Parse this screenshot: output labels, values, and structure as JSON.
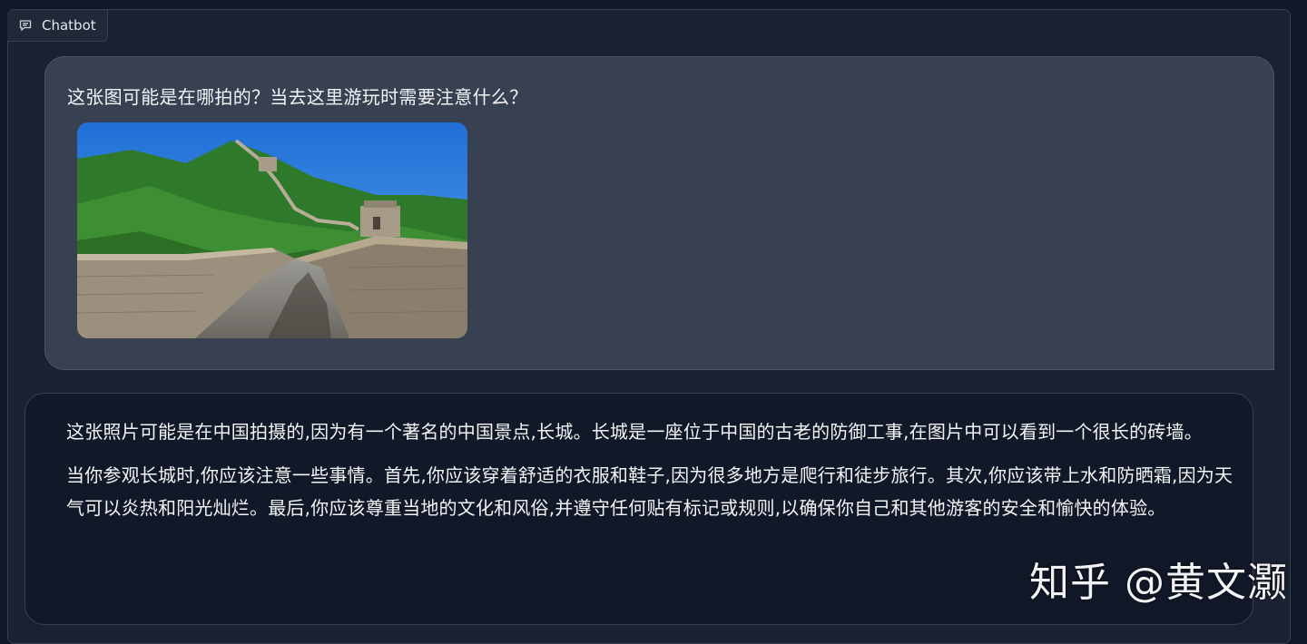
{
  "panel": {
    "label": "Chatbot",
    "label_icon": "chat-bubble-icon"
  },
  "messages": [
    {
      "role": "user",
      "text": "这张图可能是在哪拍的？当去这里游玩时需要注意什么？",
      "image_description_icon": "great-wall-photo"
    },
    {
      "role": "bot",
      "paragraphs": [
        "这张照片可能是在中国拍摄的,因为有一个著名的中国景点,长城。长城是一座位于中国的古老的防御工事,在图片中可以看到一个很长的砖墙。",
        "当你参观长城时,你应该注意一些事情。首先,你应该穿着舒适的衣服和鞋子,因为很多地方是爬行和徒步旅行。其次,你应该带上水和防晒霜,因为天气可以炎热和阳光灿烂。最后,你应该尊重当地的文化和风俗,并遵守任何贴有标记或规则,以确保你自己和其他游客的安全和愉快的体验。"
      ]
    }
  ],
  "watermark": "知乎 @黄文灏",
  "colors": {
    "background": "#111827",
    "user_bubble": "#374151",
    "bot_bubble": "#111827",
    "text": "#f3f4f6"
  }
}
